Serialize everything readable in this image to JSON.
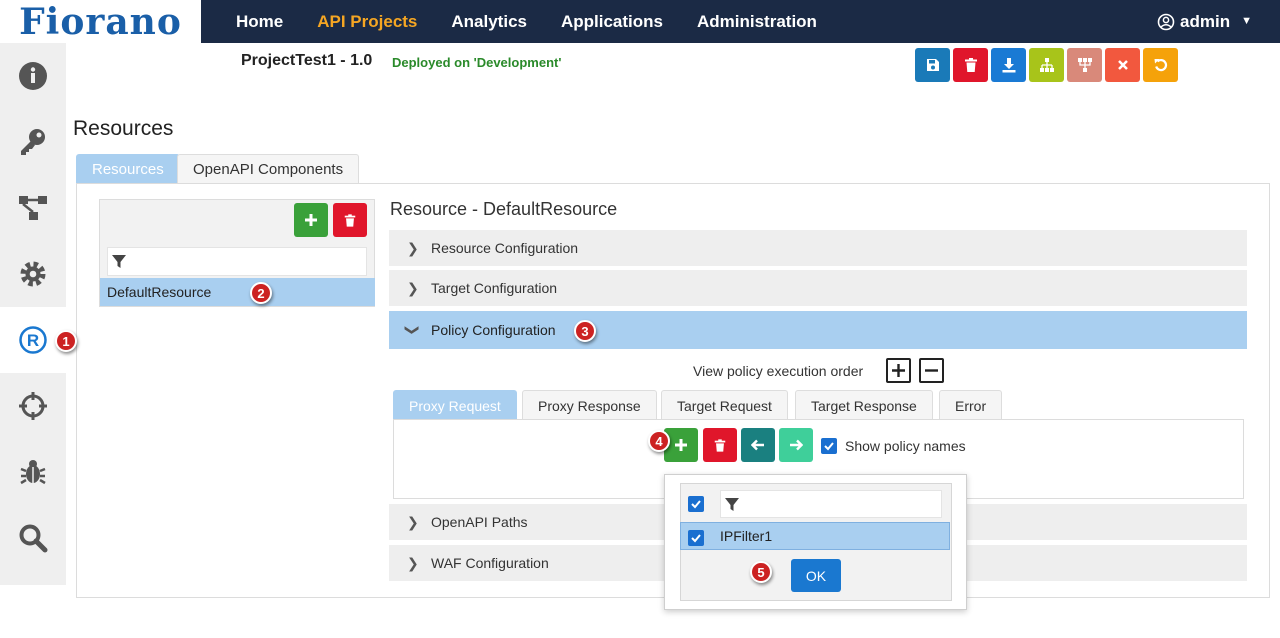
{
  "brand": {
    "logo_text": "Fiorano"
  },
  "nav": {
    "items": [
      {
        "label": "Home"
      },
      {
        "label": "API Projects"
      },
      {
        "label": "Analytics"
      },
      {
        "label": "Applications"
      },
      {
        "label": "Administration"
      }
    ],
    "active_index": 1,
    "user": "admin"
  },
  "sidebar": {
    "icons": [
      "info-icon",
      "key-icon",
      "flow-icon",
      "gear-icon",
      "registered-icon",
      "crosshair-icon",
      "bug-icon",
      "search-icon"
    ],
    "active_index": 4
  },
  "project": {
    "title": "ProjectTest1 - 1.0",
    "status": "Deployed on 'Development'"
  },
  "toolbar": {
    "buttons": [
      {
        "icon": "save-icon",
        "color": "#1a7ab8"
      },
      {
        "icon": "trash-icon",
        "color": "#e0162b"
      },
      {
        "icon": "download-icon",
        "color": "#1a7ad4"
      },
      {
        "icon": "hierarchy-icon",
        "color": "#a8c41a"
      },
      {
        "icon": "tree-icon",
        "color": "#d9897a"
      },
      {
        "icon": "close-icon",
        "color": "#f2583e"
      },
      {
        "icon": "undo-icon",
        "color": "#f5a20a"
      }
    ]
  },
  "page": {
    "title": "Resources",
    "tabs": [
      {
        "label": "Resources"
      },
      {
        "label": "OpenAPI Components"
      }
    ]
  },
  "resources": {
    "items": [
      {
        "label": "DefaultResource"
      }
    ]
  },
  "resource_detail": {
    "title": "Resource - DefaultResource",
    "sections": [
      {
        "label": "Resource Configuration"
      },
      {
        "label": "Target Configuration"
      },
      {
        "label": "Policy Configuration"
      },
      {
        "label": "OpenAPI Paths"
      },
      {
        "label": "WAF Configuration"
      }
    ]
  },
  "policy": {
    "exec_order_label": "View policy execution order",
    "tabs": [
      {
        "label": "Proxy Request"
      },
      {
        "label": "Proxy Response"
      },
      {
        "label": "Target Request"
      },
      {
        "label": "Target Response"
      },
      {
        "label": "Error"
      }
    ],
    "show_names_label": "Show policy names"
  },
  "popup": {
    "items": [
      {
        "label": "IPFilter1"
      }
    ],
    "ok_label": "OK"
  },
  "markers": [
    "1",
    "2",
    "3",
    "4",
    "5"
  ],
  "colors": {
    "nav_bg": "#1b2a45",
    "accent": "#f5a623",
    "selected": "#a9cff0",
    "status_green": "#2a8a2a"
  }
}
